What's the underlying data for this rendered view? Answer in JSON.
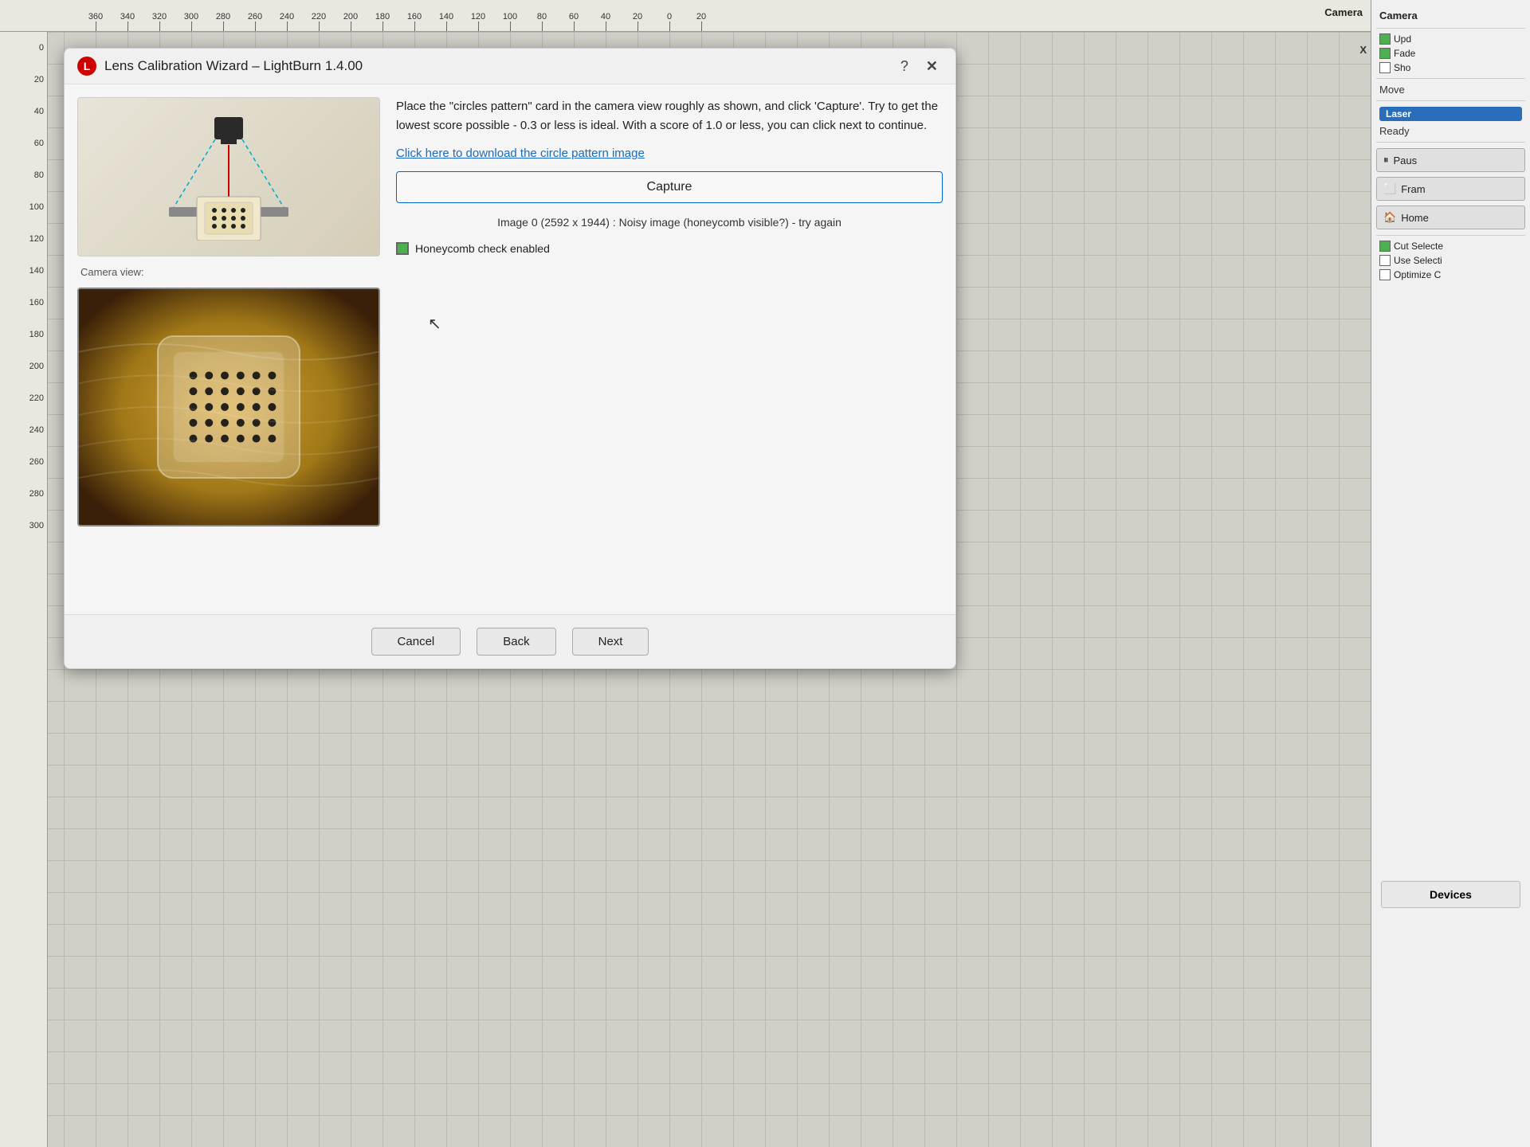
{
  "app": {
    "title": "LightBurn 1.4.00"
  },
  "ruler": {
    "top_values": [
      "360",
      "340",
      "320",
      "300",
      "280",
      "260",
      "240",
      "220",
      "200",
      "180",
      "160",
      "140",
      "120",
      "100",
      "80",
      "60",
      "40",
      "20",
      "0"
    ],
    "left_values": [
      "0",
      "20",
      "40",
      "60",
      "80",
      "100",
      "120",
      "140",
      "160",
      "180",
      "200",
      "220",
      "240",
      "260",
      "280",
      "300"
    ]
  },
  "right_panel": {
    "camera_label": "Camera",
    "update_label": "Upd",
    "fade_label": "Fade",
    "show_label": "Sho",
    "move_label": "Move",
    "laser_label": "Laser",
    "ready_label": "Ready",
    "pause_label": "Paus",
    "frame_label": "Fram",
    "home_label": "Home",
    "cut_selected_label": "Cut Selecte",
    "use_selection_label": "Use Selecti",
    "optimize_label": "Optimize C",
    "devices_label": "Devices"
  },
  "dialog": {
    "title": "Lens Calibration Wizard – LightBurn 1.4.00",
    "instruction": "Place the \"circles pattern\" card in the camera view roughly as shown, and click 'Capture'. Try to get the lowest score possible - 0.3 or less is ideal.  With a score of 1.0 or less, you can click next to continue.",
    "download_link": "Click here to download the circle pattern image",
    "camera_label": "Camera view:",
    "capture_btn": "Capture",
    "image_info": "Image 0 (2592 x 1944) : Noisy image (honeycomb visible?) -\ntry again",
    "honeycomb_label": "Honeycomb check enabled",
    "cancel_btn": "Cancel",
    "back_btn": "Back",
    "next_btn": "Next"
  }
}
